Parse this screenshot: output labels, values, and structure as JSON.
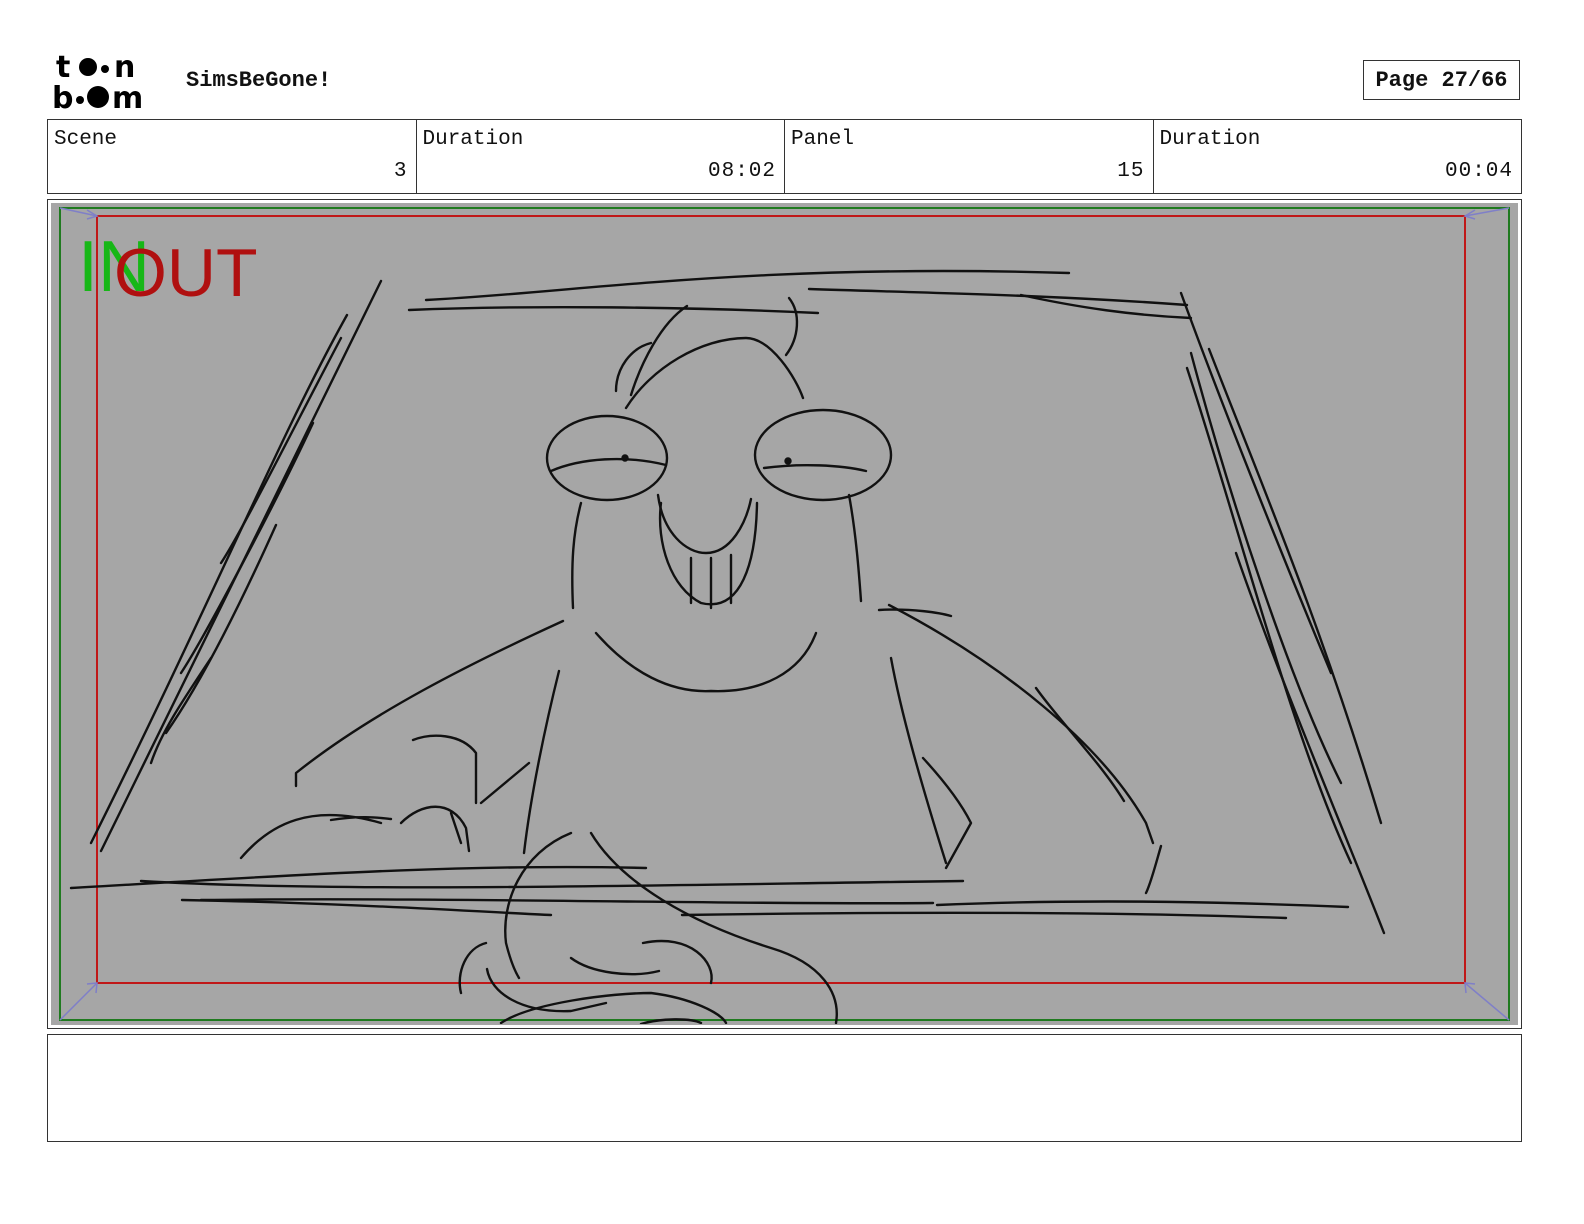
{
  "header": {
    "logo": {
      "line1": "toon",
      "line2": "boom"
    },
    "project_title": "SimsBeGone!",
    "page_label": "Page 27/66"
  },
  "info": {
    "scene_label": "Scene",
    "scene_value": "3",
    "scene_duration_label": "Duration",
    "scene_duration_value": "08:02",
    "panel_label": "Panel",
    "panel_value": "15",
    "panel_duration_label": "Duration",
    "panel_duration_value": "00:04"
  },
  "panel": {
    "in_label": "IN",
    "out_label": "OUT",
    "colors": {
      "background": "#a6a6a6",
      "in_frame": "#1f7a1f",
      "out_frame": "#c01818",
      "in_text": "#17b717",
      "out_text": "#b01010",
      "corner_arrows": "#7f7fc8"
    }
  },
  "notes": {
    "text": ""
  }
}
